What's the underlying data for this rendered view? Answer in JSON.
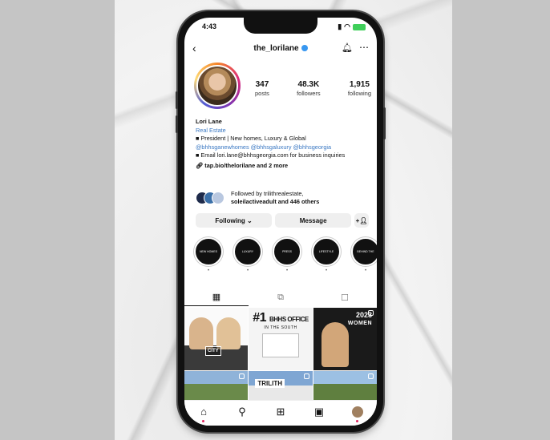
{
  "status": {
    "time": "4:43",
    "battery": ""
  },
  "header": {
    "username": "the_lorilane"
  },
  "stats": [
    {
      "num": "347",
      "label": "posts"
    },
    {
      "num": "48.3K",
      "label": "followers"
    },
    {
      "num": "1,915",
      "label": "following"
    }
  ],
  "bio": {
    "name": "Lori Lane",
    "category": "Real Estate",
    "line1": "■ President | New homes, Luxury & Global",
    "tags": "@bhhsganewhomes @bhhsgaluxury @bhhsgeorgia",
    "line2": "■ Email lori.lane@bhhsgeorgia.com for business inquiries",
    "link": "tap.bio/thelorilane and 2 more"
  },
  "followed": {
    "line1": "Followed by trilithrealestate,",
    "line2": "soleilactiveadult and 446 others"
  },
  "actions": {
    "following": "Following ⌄",
    "message": "Message"
  },
  "highlights": [
    {
      "label": "NEW HOMES"
    },
    {
      "label": "LUXURY"
    },
    {
      "label": "PRESS"
    },
    {
      "label": "LIFESTYLE"
    },
    {
      "label": "BEHIND THE"
    }
  ],
  "grid": {
    "post1_caption": "CITY",
    "post2_big": "#1",
    "post2_title": "BHHS OFFICE",
    "post2_sub": "IN THE SOUTH",
    "post3_year": "2023",
    "post3_text": "WOMEN",
    "post5_text": "TRILITH"
  }
}
